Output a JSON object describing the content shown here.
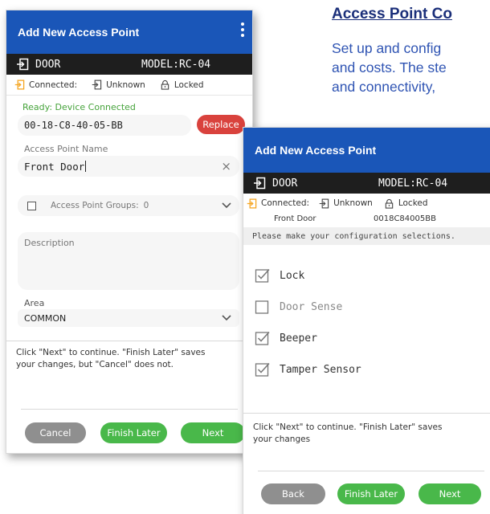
{
  "doc": {
    "heading": "Access Point Co",
    "lines": [
      "Set up and config",
      "and costs. The ste",
      "and connectivity,"
    ]
  },
  "left": {
    "title": "Add New Access Point",
    "device_name": "DOOR",
    "model": "MODEL:RC-04",
    "status_connected": "Connected:",
    "status_unknown": "Unknown",
    "status_locked": "Locked",
    "ready_label": "Ready: Device Connected",
    "mac_value": "00-18-C8-40-05-BB",
    "replace_label": "Replace",
    "name_label": "Access Point Name",
    "name_value": "Front Door",
    "groups_label": "Access Point Groups:",
    "groups_count": "0",
    "description_placeholder": "Description",
    "area_label": "Area",
    "area_value": "COMMON",
    "help_line1": "Click \"Next\" to continue. \"Finish Later\" saves",
    "help_line2": "your changes, but \"Cancel\" does not.",
    "cancel_label": "Cancel",
    "finish_label": "Finish Later",
    "next_label": "Next"
  },
  "right": {
    "title": "Add New Access Point",
    "device_name": "DOOR",
    "model": "MODEL:RC-04",
    "status_connected": "Connected:",
    "status_unknown": "Unknown",
    "status_locked": "Locked",
    "ap_name": "Front Door",
    "ap_mac": "0018C84005BB",
    "prompt": "Please make your configuration selections.",
    "options": [
      {
        "label": "Lock",
        "checked": true
      },
      {
        "label": "Door Sense",
        "checked": false
      },
      {
        "label": "Beeper",
        "checked": true
      },
      {
        "label": "Tamper Sensor",
        "checked": true
      }
    ],
    "help_line1": "Click \"Next\" to continue. \"Finish Later\" saves",
    "help_line2": "your changes",
    "back_label": "Back",
    "finish_label": "Finish Later",
    "next_label": "Next"
  },
  "colors": {
    "appbar": "#1a56b8",
    "devbar": "#1e1e1e",
    "accent_orange": "#f5a623",
    "success_green": "#46a33b",
    "button_green": "#49b84a",
    "button_red": "#d9423d",
    "doc_heading": "#1b2f7a",
    "doc_text": "#2f54b3"
  },
  "icons": {
    "device": "login-icon",
    "connected": "login-icon-orange",
    "unknown": "login-icon",
    "locked": "padlock-icon",
    "menu": "kebab-menu-icon",
    "clear": "close-icon",
    "dropdown": "chevron-down-icon",
    "checked": "checked-box-icon",
    "unchecked": "empty-box-icon"
  }
}
